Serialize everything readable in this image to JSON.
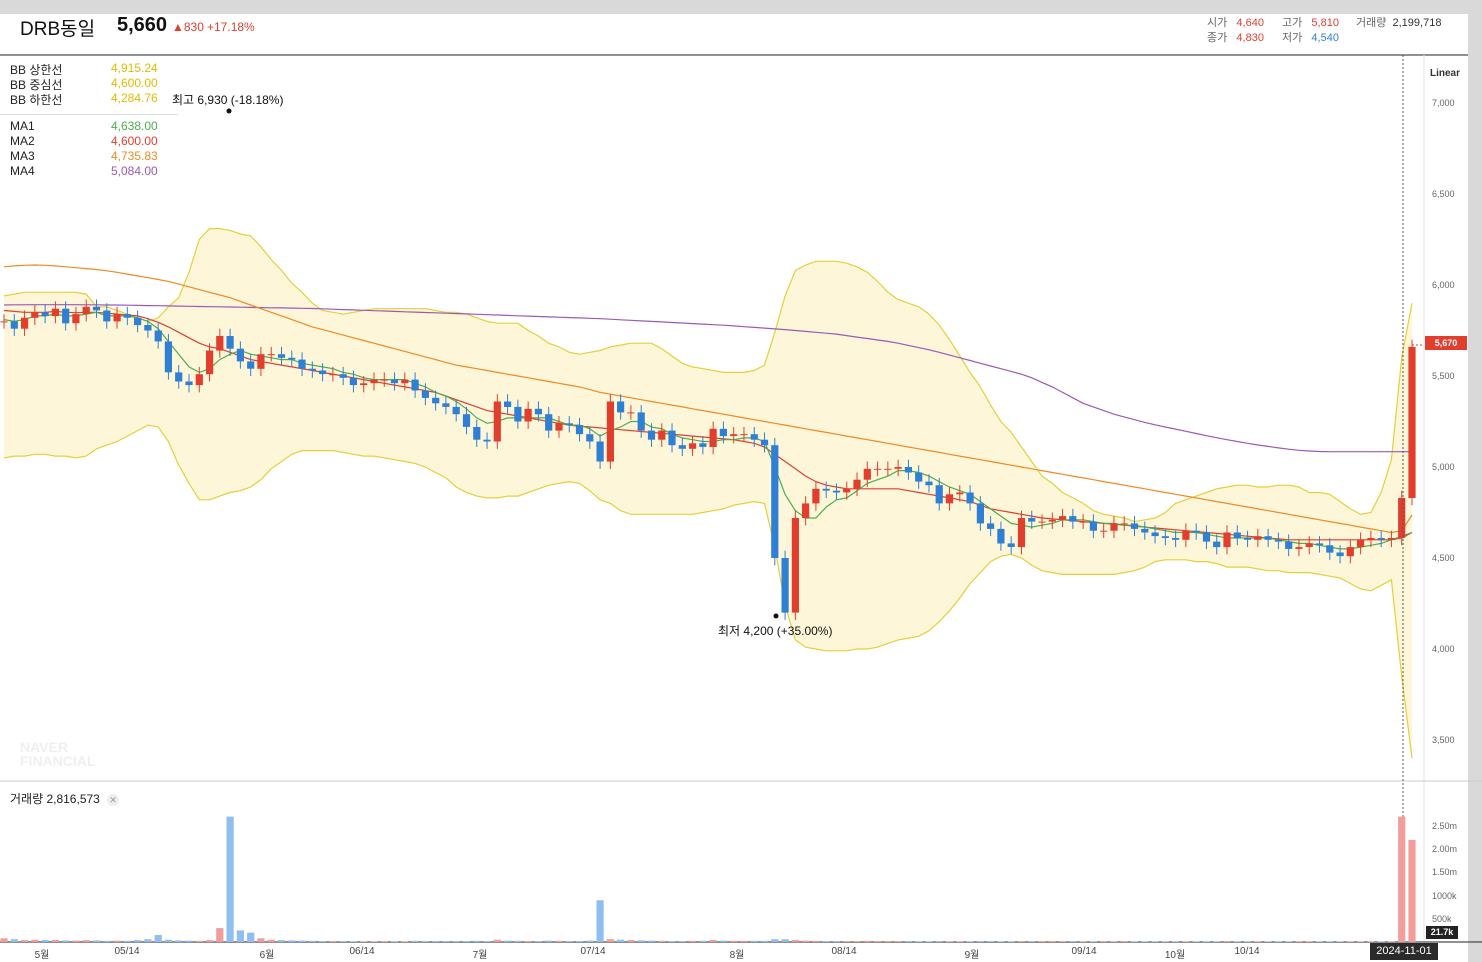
{
  "header": {
    "name": "DRB동일",
    "price": "5,660",
    "change": "▲830",
    "change_pct": "+17.18%",
    "stats": [
      {
        "label": "시가",
        "value": "4,640",
        "color": "#e23e2e"
      },
      {
        "label": "고가",
        "value": "5,810",
        "color": "#e23e2e"
      },
      {
        "label": "거래량",
        "value": "2,199,718",
        "color": "#333333"
      },
      {
        "label": "종가",
        "value": "4,830",
        "color": "#e23e2e"
      },
      {
        "label": "저가",
        "value": "4,540",
        "color": "#2f7fd4"
      }
    ]
  },
  "legend_bb": [
    {
      "label": "BB 상한선",
      "value": "4,915.24",
      "color": "#e6b800"
    },
    {
      "label": "BB 중심선",
      "value": "4,600.00",
      "color": "#e6b800"
    },
    {
      "label": "BB 하한선",
      "value": "4,284.76",
      "color": "#e6b800"
    }
  ],
  "legend_ma": [
    {
      "label": "MA1",
      "value": "4,638.00",
      "color": "#4caf50"
    },
    {
      "label": "MA2",
      "value": "4,600.00",
      "color": "#e23e2e"
    },
    {
      "label": "MA3",
      "value": "4,735.83",
      "color": "#f08a24"
    },
    {
      "label": "MA4",
      "value": "5,084.00",
      "color": "#9b59b6"
    }
  ],
  "annotations": {
    "high": "최고 6,930 (-18.18%)",
    "low": "최저 4,200 (+35.00%)"
  },
  "scale_mode": "Linear",
  "last_price_tag": "5,670",
  "volume_title": "거래량 2,816,573",
  "volume_last_tag": "21.7k",
  "date_badge": "2024-11-01",
  "watermark": "NAVER FINANCIAL",
  "chart_data": {
    "type": "candlestick",
    "x_labels": [
      "5월",
      "05/14",
      "6월",
      "06/14",
      "7월",
      "07/14",
      "8월",
      "08/14",
      "9월",
      "09/14",
      "10월",
      "10/14"
    ],
    "y_ticks": [
      7000,
      6500,
      6000,
      5500,
      5000,
      4500,
      4000,
      3500
    ],
    "y_tick_labels": [
      "7,000",
      "6,500",
      "6,000",
      "5,500",
      "5,000",
      "4,500",
      "4,000",
      "3,500"
    ],
    "ylim": [
      3300,
      7200
    ],
    "volume_ticks": [
      "2.50m",
      "2.00m",
      "1.50m",
      "1000k",
      "500k"
    ],
    "volume_tick_values": [
      2500000,
      2000000,
      1500000,
      1000000,
      500000
    ],
    "colors": {
      "up": "#e23e2e",
      "down": "#2f7fd4",
      "bb": "#e6cf3a",
      "bb_fill": "#fdf6d9",
      "ma1": "#4caf50",
      "ma2": "#e23e2e",
      "ma3": "#f08a24",
      "ma4": "#9b59b6"
    },
    "closes": [
      5800,
      5760,
      5820,
      5850,
      5830,
      5870,
      5790,
      5840,
      5880,
      5860,
      5800,
      5840,
      5820,
      5780,
      5750,
      5690,
      5520,
      5470,
      5450,
      5510,
      5640,
      5720,
      5650,
      5580,
      5540,
      5620,
      5620,
      5600,
      5590,
      5540,
      5530,
      5510,
      5510,
      5490,
      5450,
      5460,
      5480,
      5480,
      5460,
      5480,
      5420,
      5380,
      5350,
      5330,
      5290,
      5220,
      5150,
      5140,
      5360,
      5330,
      5250,
      5320,
      5290,
      5200,
      5240,
      5230,
      5180,
      5140,
      5030,
      5360,
      5300,
      5300,
      5200,
      5150,
      5200,
      5120,
      5100,
      5130,
      5110,
      5210,
      5170,
      5180,
      5180,
      5150,
      5120,
      4500,
      4200,
      4720,
      4800,
      4880,
      4870,
      4860,
      4880,
      4930,
      4990,
      4990,
      4990,
      5000,
      4970,
      4920,
      4900,
      4800,
      4850,
      4860,
      4800,
      4690,
      4660,
      4580,
      4560,
      4720,
      4700,
      4700,
      4710,
      4730,
      4700,
      4700,
      4650,
      4650,
      4690,
      4690,
      4660,
      4640,
      4620,
      4610,
      4600,
      4650,
      4640,
      4590,
      4560,
      4640,
      4610,
      4600,
      4620,
      4600,
      4590,
      4550,
      4560,
      4580,
      4570,
      4530,
      4510,
      4560,
      4600,
      4610,
      4600,
      4610,
      4830,
      5660
    ],
    "bb_upper": [
      5940,
      5950,
      5960,
      5960,
      5960,
      5960,
      5960,
      5960,
      5950,
      5880,
      5880,
      5860,
      5840,
      5820,
      5800,
      5820,
      5880,
      5930,
      6070,
      6250,
      6310,
      6310,
      6300,
      6280,
      6270,
      6210,
      6140,
      6080,
      6010,
      5960,
      5900,
      5860,
      5850,
      5840,
      5850,
      5860,
      5870,
      5870,
      5870,
      5870,
      5870,
      5870,
      5860,
      5850,
      5850,
      5840,
      5820,
      5800,
      5790,
      5790,
      5790,
      5750,
      5720,
      5680,
      5660,
      5630,
      5620,
      5630,
      5640,
      5660,
      5670,
      5680,
      5680,
      5680,
      5650,
      5610,
      5570,
      5550,
      5540,
      5530,
      5520,
      5520,
      5520,
      5530,
      5560,
      5740,
      5940,
      6080,
      6110,
      6130,
      6130,
      6130,
      6120,
      6100,
      6070,
      6020,
      5960,
      5920,
      5900,
      5880,
      5840,
      5780,
      5700,
      5610,
      5520,
      5440,
      5340,
      5250,
      5190,
      5110,
      5030,
      4950,
      4910,
      4860,
      4830,
      4800,
      4760,
      4740,
      4730,
      4720,
      4700,
      4710,
      4720,
      4750,
      4800,
      4820,
      4840,
      4860,
      4880,
      4890,
      4900,
      4900,
      4890,
      4890,
      4900,
      4900,
      4890,
      4860,
      4860,
      4850,
      4810,
      4770,
      4740,
      4750,
      4860,
      5040,
      5600,
      5900
    ],
    "bb_lower": [
      5050,
      5060,
      5060,
      5070,
      5070,
      5060,
      5060,
      5050,
      5060,
      5100,
      5120,
      5140,
      5170,
      5200,
      5230,
      5220,
      5140,
      5010,
      4910,
      4820,
      4820,
      4840,
      4860,
      4870,
      4890,
      4930,
      4990,
      5030,
      5070,
      5090,
      5090,
      5090,
      5090,
      5080,
      5070,
      5060,
      5060,
      5050,
      5040,
      5030,
      5020,
      5000,
      4970,
      4940,
      4890,
      4860,
      4840,
      4830,
      4830,
      4840,
      4840,
      4860,
      4880,
      4900,
      4910,
      4920,
      4910,
      4870,
      4820,
      4800,
      4760,
      4740,
      4740,
      4740,
      4740,
      4740,
      4740,
      4740,
      4750,
      4760,
      4770,
      4790,
      4800,
      4810,
      4800,
      4560,
      4240,
      4050,
      4010,
      4000,
      3990,
      3990,
      3990,
      4000,
      4000,
      4010,
      4030,
      4050,
      4060,
      4070,
      4100,
      4150,
      4210,
      4280,
      4360,
      4420,
      4480,
      4510,
      4520,
      4500,
      4460,
      4430,
      4420,
      4410,
      4410,
      4410,
      4410,
      4410,
      4410,
      4420,
      4430,
      4450,
      4480,
      4490,
      4490,
      4490,
      4480,
      4480,
      4470,
      4450,
      4450,
      4450,
      4440,
      4430,
      4430,
      4420,
      4420,
      4420,
      4410,
      4400,
      4390,
      4360,
      4330,
      4320,
      4350,
      4380,
      3850,
      3400
    ],
    "ma1": [
      5810,
      5800,
      5810,
      5830,
      5830,
      5840,
      5830,
      5830,
      5840,
      5850,
      5830,
      5830,
      5830,
      5820,
      5800,
      5760,
      5690,
      5620,
      5550,
      5520,
      5540,
      5590,
      5620,
      5640,
      5620,
      5610,
      5600,
      5590,
      5590,
      5570,
      5560,
      5550,
      5540,
      5520,
      5510,
      5490,
      5480,
      5480,
      5480,
      5480,
      5460,
      5440,
      5410,
      5390,
      5360,
      5320,
      5270,
      5240,
      5250,
      5270,
      5270,
      5270,
      5270,
      5270,
      5250,
      5230,
      5230,
      5210,
      5170,
      5200,
      5220,
      5250,
      5250,
      5220,
      5210,
      5180,
      5160,
      5150,
      5140,
      5140,
      5150,
      5150,
      5160,
      5160,
      5140,
      5000,
      4850,
      4760,
      4720,
      4720,
      4780,
      4820,
      4830,
      4870,
      4910,
      4930,
      4950,
      4980,
      4980,
      4970,
      4950,
      4920,
      4890,
      4870,
      4850,
      4810,
      4770,
      4730,
      4690,
      4680,
      4670,
      4680,
      4690,
      4710,
      4710,
      4710,
      4700,
      4690,
      4690,
      4680,
      4680,
      4670,
      4660,
      4650,
      4640,
      4640,
      4640,
      4630,
      4620,
      4610,
      4610,
      4610,
      4610,
      4610,
      4600,
      4590,
      4580,
      4580,
      4570,
      4560,
      4550,
      4550,
      4560,
      4570,
      4580,
      4600,
      4620,
      4640
    ],
    "ma2": [
      5860,
      5855,
      5850,
      5850,
      5850,
      5855,
      5850,
      5848,
      5850,
      5850,
      5845,
      5840,
      5835,
      5830,
      5815,
      5795,
      5770,
      5740,
      5710,
      5680,
      5660,
      5650,
      5630,
      5610,
      5590,
      5580,
      5570,
      5560,
      5550,
      5540,
      5530,
      5520,
      5510,
      5500,
      5490,
      5480,
      5470,
      5460,
      5450,
      5440,
      5430,
      5420,
      5410,
      5390,
      5370,
      5350,
      5330,
      5310,
      5300,
      5290,
      5280,
      5270,
      5260,
      5250,
      5240,
      5230,
      5225,
      5220,
      5215,
      5210,
      5205,
      5200,
      5195,
      5190,
      5185,
      5180,
      5175,
      5170,
      5165,
      5160,
      5155,
      5150,
      5140,
      5130,
      5110,
      5070,
      5030,
      4990,
      4950,
      4920,
      4900,
      4890,
      4880,
      4880,
      4880,
      4880,
      4880,
      4880,
      4870,
      4860,
      4850,
      4840,
      4830,
      4820,
      4810,
      4790,
      4770,
      4760,
      4750,
      4740,
      4730,
      4720,
      4715,
      4710,
      4705,
      4700,
      4695,
      4690,
      4685,
      4680,
      4675,
      4670,
      4665,
      4660,
      4655,
      4650,
      4645,
      4640,
      4635,
      4630,
      4625,
      4620,
      4615,
      4610,
      4605,
      4600,
      4600,
      4600,
      4600,
      4600,
      4600,
      4600,
      4600,
      4600,
      4600,
      4600,
      4610,
      4640
    ],
    "ma3": [
      6100,
      6105,
      6108,
      6110,
      6108,
      6105,
      6100,
      6095,
      6090,
      6085,
      6078,
      6070,
      6060,
      6050,
      6040,
      6030,
      6020,
      6005,
      5990,
      5975,
      5960,
      5945,
      5930,
      5910,
      5890,
      5870,
      5850,
      5830,
      5810,
      5790,
      5770,
      5755,
      5740,
      5725,
      5710,
      5695,
      5680,
      5665,
      5650,
      5635,
      5620,
      5605,
      5590,
      5575,
      5560,
      5550,
      5540,
      5530,
      5520,
      5510,
      5500,
      5490,
      5480,
      5470,
      5460,
      5450,
      5440,
      5425,
      5410,
      5400,
      5390,
      5380,
      5370,
      5360,
      5350,
      5340,
      5330,
      5320,
      5310,
      5300,
      5290,
      5280,
      5270,
      5260,
      5250,
      5240,
      5230,
      5220,
      5210,
      5200,
      5190,
      5180,
      5170,
      5160,
      5150,
      5140,
      5130,
      5120,
      5110,
      5100,
      5090,
      5080,
      5070,
      5060,
      5050,
      5040,
      5030,
      5020,
      5010,
      5000,
      4990,
      4980,
      4970,
      4960,
      4950,
      4940,
      4930,
      4920,
      4910,
      4900,
      4890,
      4880,
      4870,
      4860,
      4850,
      4840,
      4830,
      4820,
      4810,
      4800,
      4790,
      4780,
      4770,
      4760,
      4750,
      4740,
      4730,
      4720,
      4710,
      4700,
      4690,
      4680,
      4670,
      4660,
      4650,
      4640,
      4650,
      4736
    ],
    "ma4": [
      5890,
      5891,
      5891,
      5892,
      5892,
      5892,
      5892,
      5892,
      5891,
      5891,
      5890,
      5890,
      5889,
      5888,
      5887,
      5886,
      5885,
      5884,
      5883,
      5882,
      5881,
      5880,
      5879,
      5878,
      5877,
      5876,
      5875,
      5874,
      5873,
      5872,
      5871,
      5869,
      5867,
      5865,
      5863,
      5861,
      5859,
      5857,
      5855,
      5853,
      5851,
      5849,
      5847,
      5845,
      5843,
      5841,
      5839,
      5837,
      5835,
      5833,
      5831,
      5829,
      5827,
      5825,
      5823,
      5821,
      5819,
      5817,
      5815,
      5812,
      5809,
      5806,
      5803,
      5800,
      5797,
      5794,
      5791,
      5788,
      5785,
      5782,
      5779,
      5775,
      5771,
      5767,
      5763,
      5759,
      5755,
      5750,
      5745,
      5740,
      5735,
      5730,
      5722,
      5714,
      5706,
      5698,
      5690,
      5680,
      5668,
      5656,
      5644,
      5630,
      5615,
      5600,
      5585,
      5570,
      5555,
      5540,
      5525,
      5510,
      5490,
      5465,
      5440,
      5410,
      5380,
      5350,
      5330,
      5310,
      5290,
      5275,
      5260,
      5245,
      5232,
      5220,
      5208,
      5196,
      5184,
      5172,
      5161,
      5150,
      5140,
      5130,
      5121,
      5113,
      5105,
      5098,
      5092,
      5088,
      5085,
      5084,
      5084,
      5084,
      5084,
      5084,
      5084,
      5084,
      5084,
      5084
    ],
    "volume": [
      80000,
      60000,
      40000,
      50000,
      40000,
      45000,
      35000,
      30000,
      40000,
      35000,
      25000,
      30000,
      25000,
      40000,
      60000,
      150000,
      50000,
      35000,
      30000,
      25000,
      40000,
      300000,
      2700000,
      250000,
      200000,
      80000,
      50000,
      40000,
      35000,
      30000,
      25000,
      20000,
      20000,
      20000,
      15000,
      15000,
      15000,
      20000,
      15000,
      15000,
      25000,
      20000,
      20000,
      20000,
      20000,
      20000,
      25000,
      20000,
      50000,
      30000,
      25000,
      20000,
      20000,
      30000,
      25000,
      20000,
      20000,
      30000,
      900000,
      60000,
      50000,
      40000,
      35000,
      30000,
      25000,
      20000,
      20000,
      25000,
      25000,
      45000,
      30000,
      25000,
      25000,
      25000,
      25000,
      60000,
      60000,
      45000,
      30000,
      25000,
      20000,
      20000,
      20000,
      20000,
      25000,
      20000,
      20000,
      20000,
      20000,
      15000,
      15000,
      20000,
      15000,
      15000,
      15000,
      20000,
      20000,
      15000,
      15000,
      20000,
      20000,
      20000,
      20000,
      20000,
      20000,
      15000,
      15000,
      20000,
      15000,
      20000,
      15000,
      15000,
      15000,
      15000,
      15000,
      15000,
      15000,
      15000,
      15000,
      20000,
      15000,
      15000,
      15000,
      15000,
      15000,
      15000,
      15000,
      15000,
      15000,
      15000,
      15000,
      15000,
      15000,
      15000,
      15000,
      15000,
      2700000,
      2199718
    ]
  }
}
